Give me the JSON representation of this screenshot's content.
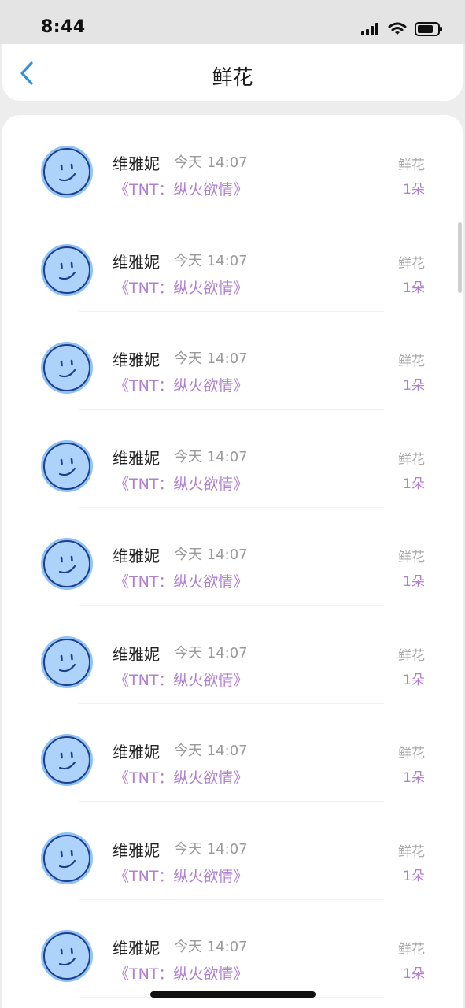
{
  "status_bar": {
    "time": "8:44"
  },
  "header": {
    "title": "鲜花"
  },
  "rows": [
    {
      "name": "维雅妮",
      "time": "今天 14:07",
      "book": "《TNT：纵火欲情》",
      "gift_label": "鲜花",
      "gift_count": "1朵"
    },
    {
      "name": "维雅妮",
      "time": "今天 14:07",
      "book": "《TNT：纵火欲情》",
      "gift_label": "鲜花",
      "gift_count": "1朵"
    },
    {
      "name": "维雅妮",
      "time": "今天 14:07",
      "book": "《TNT：纵火欲情》",
      "gift_label": "鲜花",
      "gift_count": "1朵"
    },
    {
      "name": "维雅妮",
      "time": "今天 14:07",
      "book": "《TNT：纵火欲情》",
      "gift_label": "鲜花",
      "gift_count": "1朵"
    },
    {
      "name": "维雅妮",
      "time": "今天 14:07",
      "book": "《TNT：纵火欲情》",
      "gift_label": "鲜花",
      "gift_count": "1朵"
    },
    {
      "name": "维雅妮",
      "time": "今天 14:07",
      "book": "《TNT：纵火欲情》",
      "gift_label": "鲜花",
      "gift_count": "1朵"
    },
    {
      "name": "维雅妮",
      "time": "今天 14:07",
      "book": "《TNT：纵火欲情》",
      "gift_label": "鲜花",
      "gift_count": "1朵"
    },
    {
      "name": "维雅妮",
      "time": "今天 14:07",
      "book": "《TNT：纵火欲情》",
      "gift_label": "鲜花",
      "gift_count": "1朵"
    },
    {
      "name": "维雅妮",
      "time": "今天 14:07",
      "book": "《TNT：纵火欲情》",
      "gift_label": "鲜花",
      "gift_count": "1朵"
    }
  ],
  "colors": {
    "accent_purple": "#b07fd2",
    "back_arrow_blue": "#2f8fe0",
    "avatar_fill": "#aed3fb",
    "avatar_ring": "#8fc2f7",
    "avatar_stroke": "#1e3f8a"
  },
  "icons": {
    "back": "chevron-left-icon",
    "avatar": "smiley-face-icon",
    "signal": "cellular-signal-icon",
    "wifi": "wifi-icon",
    "battery": "battery-icon"
  }
}
